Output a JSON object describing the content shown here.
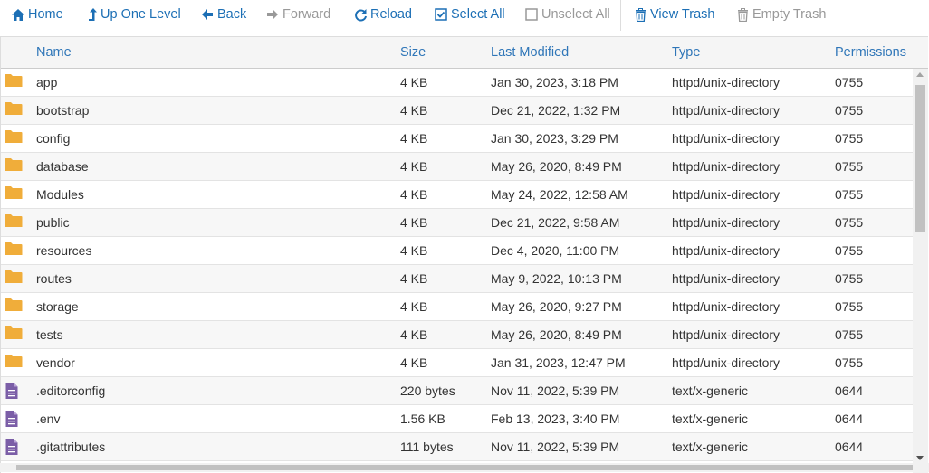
{
  "toolbar": {
    "home": "Home",
    "up": "Up One Level",
    "back": "Back",
    "forward": "Forward",
    "reload": "Reload",
    "select_all": "Select All",
    "unselect_all": "Unselect All",
    "view_trash": "View Trash",
    "empty_trash": "Empty Trash"
  },
  "columns": {
    "name": "Name",
    "size": "Size",
    "modified": "Last Modified",
    "type": "Type",
    "permissions": "Permissions"
  },
  "colors": {
    "link": "#1c6fb5",
    "folder": "#f0ad3a",
    "file": "#7b5ea7"
  },
  "files": [
    {
      "icon": "folder-icon",
      "name": "app",
      "size": "4 KB",
      "modified": "Jan 30, 2023, 3:18 PM",
      "type": "httpd/unix-directory",
      "perm": "0755"
    },
    {
      "icon": "folder-icon",
      "name": "bootstrap",
      "size": "4 KB",
      "modified": "Dec 21, 2022, 1:32 PM",
      "type": "httpd/unix-directory",
      "perm": "0755"
    },
    {
      "icon": "folder-icon",
      "name": "config",
      "size": "4 KB",
      "modified": "Jan 30, 2023, 3:29 PM",
      "type": "httpd/unix-directory",
      "perm": "0755"
    },
    {
      "icon": "folder-icon",
      "name": "database",
      "size": "4 KB",
      "modified": "May 26, 2020, 8:49 PM",
      "type": "httpd/unix-directory",
      "perm": "0755"
    },
    {
      "icon": "folder-icon",
      "name": "Modules",
      "size": "4 KB",
      "modified": "May 24, 2022, 12:58 AM",
      "type": "httpd/unix-directory",
      "perm": "0755"
    },
    {
      "icon": "folder-icon",
      "name": "public",
      "size": "4 KB",
      "modified": "Dec 21, 2022, 9:58 AM",
      "type": "httpd/unix-directory",
      "perm": "0755"
    },
    {
      "icon": "folder-icon",
      "name": "resources",
      "size": "4 KB",
      "modified": "Dec 4, 2020, 11:00 PM",
      "type": "httpd/unix-directory",
      "perm": "0755"
    },
    {
      "icon": "folder-icon",
      "name": "routes",
      "size": "4 KB",
      "modified": "May 9, 2022, 10:13 PM",
      "type": "httpd/unix-directory",
      "perm": "0755"
    },
    {
      "icon": "folder-icon",
      "name": "storage",
      "size": "4 KB",
      "modified": "May 26, 2020, 9:27 PM",
      "type": "httpd/unix-directory",
      "perm": "0755"
    },
    {
      "icon": "folder-icon",
      "name": "tests",
      "size": "4 KB",
      "modified": "May 26, 2020, 8:49 PM",
      "type": "httpd/unix-directory",
      "perm": "0755"
    },
    {
      "icon": "folder-icon",
      "name": "vendor",
      "size": "4 KB",
      "modified": "Jan 31, 2023, 12:47 PM",
      "type": "httpd/unix-directory",
      "perm": "0755"
    },
    {
      "icon": "file-icon",
      "name": ".editorconfig",
      "size": "220 bytes",
      "modified": "Nov 11, 2022, 5:39 PM",
      "type": "text/x-generic",
      "perm": "0644"
    },
    {
      "icon": "file-icon",
      "name": ".env",
      "size": "1.56 KB",
      "modified": "Feb 13, 2023, 3:40 PM",
      "type": "text/x-generic",
      "perm": "0644"
    },
    {
      "icon": "file-icon",
      "name": ".gitattributes",
      "size": "111 bytes",
      "modified": "Nov 11, 2022, 5:39 PM",
      "type": "text/x-generic",
      "perm": "0644"
    }
  ]
}
